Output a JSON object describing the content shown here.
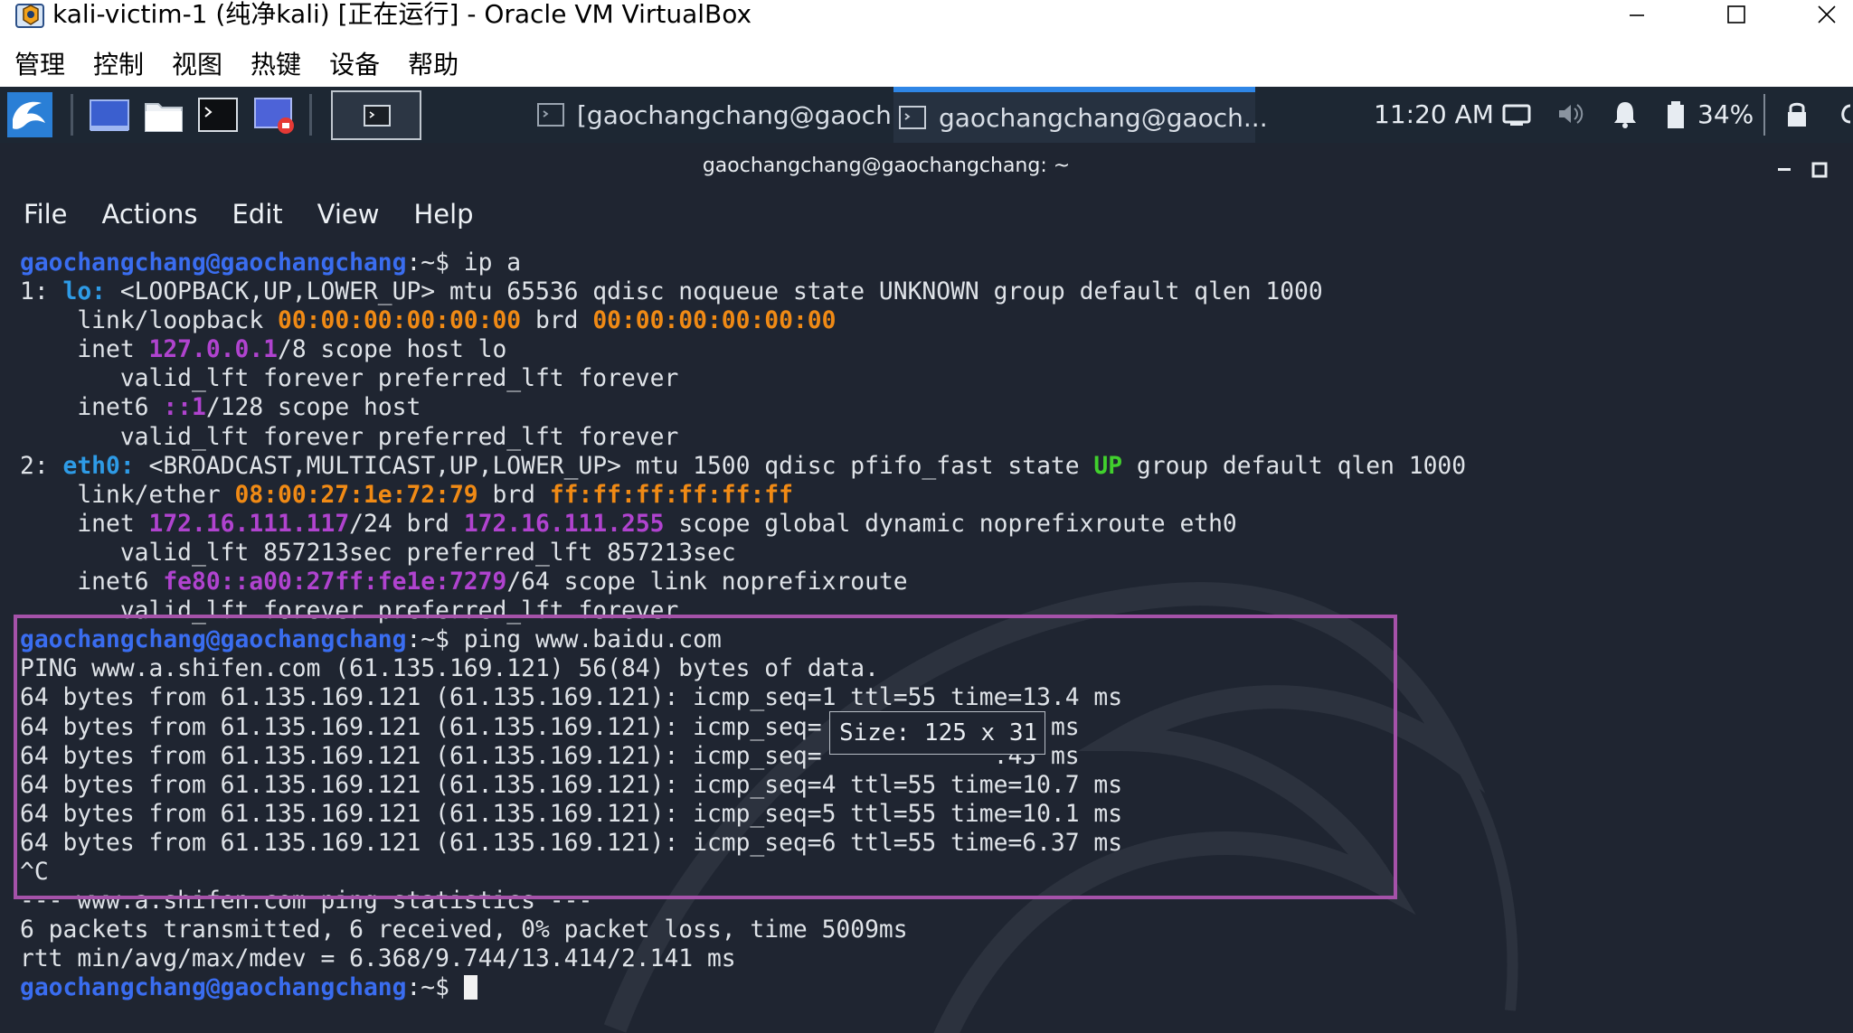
{
  "window": {
    "title": "kali-victim-1 (纯净kali) [正在运行] - Oracle VM VirtualBox",
    "app_icon": "virtualbox-icon",
    "controls": [
      "minimize-icon",
      "maximize-icon",
      "close-icon"
    ]
  },
  "menubar": {
    "items": [
      "管理",
      "控制",
      "视图",
      "热键",
      "设备",
      "帮助"
    ]
  },
  "panel": {
    "tasks": [
      {
        "label": "[gaochangchang@gaoch...",
        "active": false
      },
      {
        "label": "gaochangchang@gaoch...",
        "active": true
      }
    ],
    "clock": "11:20 AM",
    "battery": "34%",
    "tray_icons": [
      "display-icon",
      "volume-icon",
      "bell-icon",
      "battery-icon",
      "lock-icon",
      "power-icon"
    ]
  },
  "terminal": {
    "title": "gaochangchang@gaochangchang: ~",
    "menu": [
      "File",
      "Actions",
      "Edit",
      "View",
      "Help"
    ],
    "lines": [
      [
        {
          "t": "gaochangchang@gaochangchang",
          "c": "prompt-user"
        },
        {
          "t": ":~$ ip a",
          "c": "c-white"
        }
      ],
      [
        {
          "t": "1: ",
          "c": "c-white"
        },
        {
          "t": "lo:",
          "c": "c-cyan"
        },
        {
          "t": " <LOOPBACK,UP,LOWER_UP> mtu 65536 qdisc noqueue state UNKNOWN group default qlen 1000",
          "c": "c-white"
        }
      ],
      [
        {
          "t": "    link/loopback ",
          "c": "c-white"
        },
        {
          "t": "00:00:00:00:00:00",
          "c": "c-orange"
        },
        {
          "t": " brd ",
          "c": "c-white"
        },
        {
          "t": "00:00:00:00:00:00",
          "c": "c-orange"
        }
      ],
      [
        {
          "t": "    inet ",
          "c": "c-white"
        },
        {
          "t": "127.0.0.1",
          "c": "c-purple"
        },
        {
          "t": "/8 scope host lo",
          "c": "c-white"
        }
      ],
      [
        {
          "t": "       valid_lft forever preferred_lft forever",
          "c": "c-white"
        }
      ],
      [
        {
          "t": "    inet6 ",
          "c": "c-white"
        },
        {
          "t": "::1",
          "c": "c-purple"
        },
        {
          "t": "/128 scope host",
          "c": "c-white"
        }
      ],
      [
        {
          "t": "       valid_lft forever preferred_lft forever",
          "c": "c-white"
        }
      ],
      [
        {
          "t": "2: ",
          "c": "c-white"
        },
        {
          "t": "eth0:",
          "c": "c-cyan"
        },
        {
          "t": " <BROADCAST,MULTICAST,UP,LOWER_UP> mtu 1500 qdisc pfifo_fast state ",
          "c": "c-white"
        },
        {
          "t": "UP",
          "c": "c-green"
        },
        {
          "t": " group default qlen 1000",
          "c": "c-white"
        }
      ],
      [
        {
          "t": "    link/ether ",
          "c": "c-white"
        },
        {
          "t": "08:00:27:1e:72:79",
          "c": "c-orange"
        },
        {
          "t": " brd ",
          "c": "c-white"
        },
        {
          "t": "ff:ff:ff:ff:ff:ff",
          "c": "c-orange"
        }
      ],
      [
        {
          "t": "    inet ",
          "c": "c-white"
        },
        {
          "t": "172.16.111.117",
          "c": "c-purple"
        },
        {
          "t": "/24 brd ",
          "c": "c-white"
        },
        {
          "t": "172.16.111.255",
          "c": "c-purple"
        },
        {
          "t": " scope global dynamic noprefixroute eth0",
          "c": "c-white"
        }
      ],
      [
        {
          "t": "       valid_lft 857213sec preferred_lft 857213sec",
          "c": "c-white"
        }
      ],
      [
        {
          "t": "    inet6 ",
          "c": "c-white"
        },
        {
          "t": "fe80::a00:27ff:fe1e:7279",
          "c": "c-purple"
        },
        {
          "t": "/64 scope link noprefixroute",
          "c": "c-white"
        }
      ],
      [
        {
          "t": "       valid_lft forever preferred_lft forever",
          "c": "c-white"
        }
      ],
      [
        {
          "t": "gaochangchang@gaochangchang",
          "c": "prompt-user"
        },
        {
          "t": ":~$ ping www.baidu.com",
          "c": "c-white"
        }
      ],
      [
        {
          "t": "PING www.a.shifen.com (61.135.169.121) 56(84) bytes of data.",
          "c": "c-white"
        }
      ],
      [
        {
          "t": "64 bytes from 61.135.169.121 (61.135.169.121): icmp_seq=1 ttl=55 time=13.4 ms",
          "c": "c-white"
        }
      ],
      [
        {
          "t": "64 bytes from 61.135.169.121 (61.135.169.121): icmp_seq=",
          "c": "c-white"
        },
        {
          "t": "            ",
          "c": "c-white"
        },
        {
          "t": ".48 ms",
          "c": "c-white"
        }
      ],
      [
        {
          "t": "64 bytes from 61.135.169.121 (61.135.169.121): icmp_seq=",
          "c": "c-white"
        },
        {
          "t": "            ",
          "c": "c-white"
        },
        {
          "t": ".45 ms",
          "c": "c-white"
        }
      ],
      [
        {
          "t": "64 bytes from 61.135.169.121 (61.135.169.121): icmp_seq=4 ttl=55 time=10.7 ms",
          "c": "c-white"
        }
      ],
      [
        {
          "t": "64 bytes from 61.135.169.121 (61.135.169.121): icmp_seq=5 ttl=55 time=10.1 ms",
          "c": "c-white"
        }
      ],
      [
        {
          "t": "64 bytes from 61.135.169.121 (61.135.169.121): icmp_seq=6 ttl=55 time=6.37 ms",
          "c": "c-white"
        }
      ],
      [
        {
          "t": "^C",
          "c": "c-white"
        }
      ],
      [
        {
          "t": "--- www.a.shifen.com ping statistics ---",
          "c": "c-white"
        }
      ],
      [
        {
          "t": "6 packets transmitted, 6 received, 0% packet loss, time 5009ms",
          "c": "c-white"
        }
      ],
      [
        {
          "t": "rtt min/avg/max/mdev = 6.368/9.744/13.414/2.141 ms",
          "c": "c-white"
        }
      ],
      [
        {
          "t": "gaochangchang@gaochangchang",
          "c": "prompt-user"
        },
        {
          "t": ":~$ ",
          "c": "c-white"
        }
      ]
    ]
  },
  "overlay": {
    "size_tooltip": "Size: 125 x 31"
  },
  "colors": {
    "terminal_bg": "#1f2531",
    "panel_bg": "#1d2733",
    "prompt": "#3a6df0",
    "highlight": "#a552a9"
  }
}
